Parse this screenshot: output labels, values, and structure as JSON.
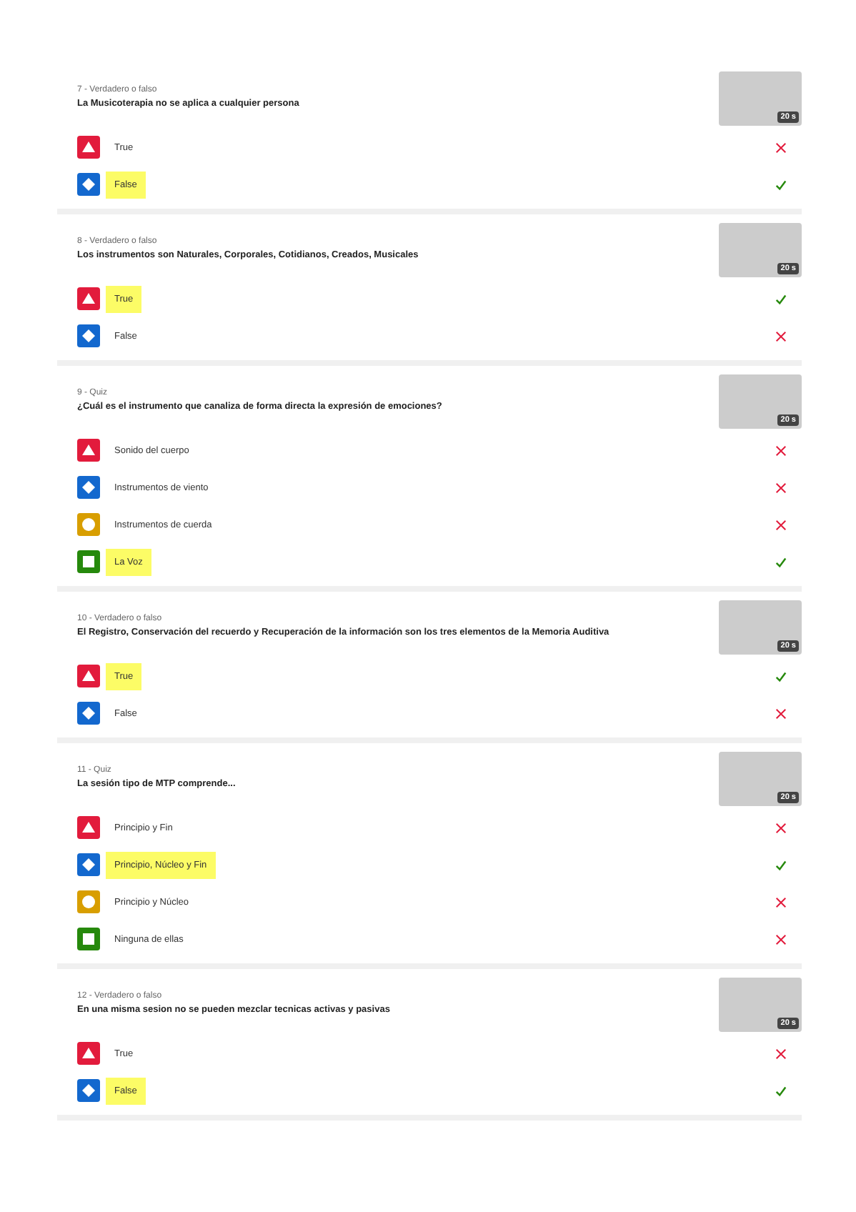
{
  "questions": [
    {
      "label": "7 - Verdadero o falso",
      "text": "La Musicoterapia no se aplica a cualquier persona",
      "time": "20 s",
      "answers": [
        {
          "kind": "triangle",
          "text": "True",
          "selected": false,
          "correct": false
        },
        {
          "kind": "diamond",
          "text": "False",
          "selected": true,
          "correct": true
        }
      ]
    },
    {
      "label": "8 - Verdadero o falso",
      "text": "Los instrumentos son Naturales, Corporales, Cotidianos, Creados, Musicales",
      "time": "20 s",
      "answers": [
        {
          "kind": "triangle",
          "text": "True",
          "selected": true,
          "correct": true
        },
        {
          "kind": "diamond",
          "text": "False",
          "selected": false,
          "correct": false
        }
      ]
    },
    {
      "label": "9 - Quiz",
      "text": "¿Cuál es el instrumento que canaliza de forma directa la expresión de emociones?",
      "time": "20 s",
      "answers": [
        {
          "kind": "triangle",
          "text": "Sonido del cuerpo",
          "selected": false,
          "correct": false
        },
        {
          "kind": "diamond",
          "text": "Instrumentos de viento",
          "selected": false,
          "correct": false
        },
        {
          "kind": "circle",
          "text": "Instrumentos de cuerda",
          "selected": false,
          "correct": false
        },
        {
          "kind": "square",
          "text": "La Voz",
          "selected": true,
          "correct": true
        }
      ]
    },
    {
      "label": "10 - Verdadero o falso",
      "text": "El Registro, Conservación del recuerdo y Recuperación de la información son los tres elementos de la Memoria Auditiva",
      "time": "20 s",
      "answers": [
        {
          "kind": "triangle",
          "text": "True",
          "selected": true,
          "correct": true
        },
        {
          "kind": "diamond",
          "text": "False",
          "selected": false,
          "correct": false
        }
      ]
    },
    {
      "label": "11 - Quiz",
      "text": "La sesión tipo de MTP comprende...",
      "time": "20 s",
      "answers": [
        {
          "kind": "triangle",
          "text": "Principio y Fin",
          "selected": false,
          "correct": false
        },
        {
          "kind": "diamond",
          "text": "Principio, Núcleo y Fin",
          "selected": true,
          "correct": true
        },
        {
          "kind": "circle",
          "text": "Principio y Núcleo",
          "selected": false,
          "correct": false
        },
        {
          "kind": "square",
          "text": "Ninguna de ellas",
          "selected": false,
          "correct": false
        }
      ]
    },
    {
      "label": "12 - Verdadero o falso",
      "text": "En una misma sesion no se pueden mezclar tecnicas activas y pasivas",
      "time": "20 s",
      "answers": [
        {
          "kind": "triangle",
          "text": "True",
          "selected": false,
          "correct": false
        },
        {
          "kind": "diamond",
          "text": "False",
          "selected": true,
          "correct": true
        }
      ]
    }
  ]
}
